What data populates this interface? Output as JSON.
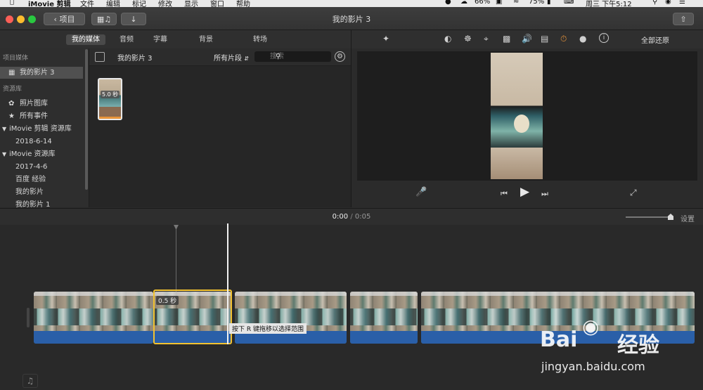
{
  "menubar": {
    "app_name": "iMovie 剪辑",
    "items": [
      "文件",
      "编辑",
      "标记",
      "修改",
      "显示",
      "窗口",
      "帮助"
    ],
    "battery": "66%",
    "battery2": "75%",
    "clock": "周三 下午5:12"
  },
  "toolbar": {
    "back_label": "项目",
    "title": "我的影片 3"
  },
  "tabs": [
    "我的媒体",
    "音频",
    "字幕",
    "背景",
    "转场"
  ],
  "sidebar": {
    "section1": "项目媒体",
    "project": "我的影片 3",
    "section2": "资源库",
    "photos": "照片图库",
    "all_events": "所有事件",
    "library1": "iMovie 剪辑 资源库",
    "lib1_event": "2018-6-14",
    "library2": "iMovie 资源库",
    "lib2_events": [
      "2017-4-6",
      "百度 经验",
      "我的影片",
      "我的影片 1"
    ]
  },
  "browser": {
    "title": "我的影片 3",
    "filter": "所有片段",
    "search_placeholder": "搜索",
    "thumb_duration": "5.0 秒"
  },
  "viewer": {
    "reset_all": "全部还原"
  },
  "timeline": {
    "current_time": "0:00",
    "separator": "/",
    "total_time": "0:05",
    "settings": "设置",
    "selected_duration": "0.5 秒",
    "tooltip": "按下 R 键拖移以选择范围"
  },
  "watermark": {
    "line1": "Bai",
    "line2": "经验",
    "url": "jingyan.baidu.com"
  },
  "colors": {
    "accent_yellow": "#f2c230",
    "audio_blue": "#2a5fa8",
    "volume_blue": "#3b8ef0",
    "speed_orange": "#e8953a"
  }
}
